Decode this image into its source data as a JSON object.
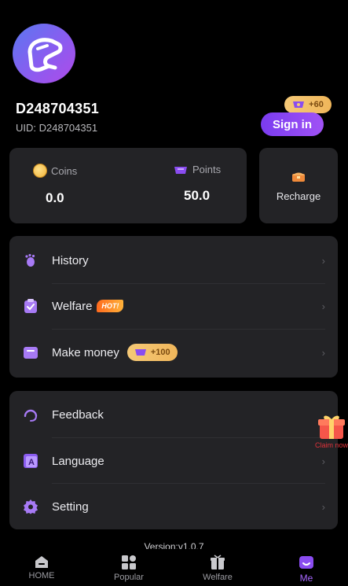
{
  "profile": {
    "username": "D248704351",
    "uid": "UID: D248704351"
  },
  "signin": {
    "bonus": "+60",
    "button": "Sign in"
  },
  "wallet": {
    "coins_label": "Coins",
    "coins_value": "0.0",
    "points_label": "Points",
    "points_value": "50.0",
    "recharge_label": "Recharge"
  },
  "menu_primary": [
    {
      "label": "History",
      "icon": "footprints-icon"
    },
    {
      "label": "Welfare",
      "icon": "clipboard-check-icon",
      "badge": "HOT!"
    },
    {
      "label": "Make money",
      "icon": "wallet-icon",
      "bonus": "+100"
    }
  ],
  "menu_secondary": [
    {
      "label": "Feedback",
      "icon": "headset-icon"
    },
    {
      "label": "Language",
      "icon": "language-icon"
    },
    {
      "label": "Setting",
      "icon": "gear-icon"
    }
  ],
  "floating": {
    "claim": "Claim now"
  },
  "footer": {
    "version": "Version:v1.0.7"
  },
  "tabs": [
    {
      "label": "HOME",
      "icon": "home-icon",
      "active": false
    },
    {
      "label": "Popular",
      "icon": "grid-icon",
      "active": false
    },
    {
      "label": "Welfare",
      "icon": "gift-box-icon",
      "active": false
    },
    {
      "label": "Me",
      "icon": "user-icon",
      "active": true
    }
  ],
  "colors": {
    "accent": "#a052f5",
    "gold": "#f0b65a",
    "card": "#232326",
    "background": "#000000"
  }
}
